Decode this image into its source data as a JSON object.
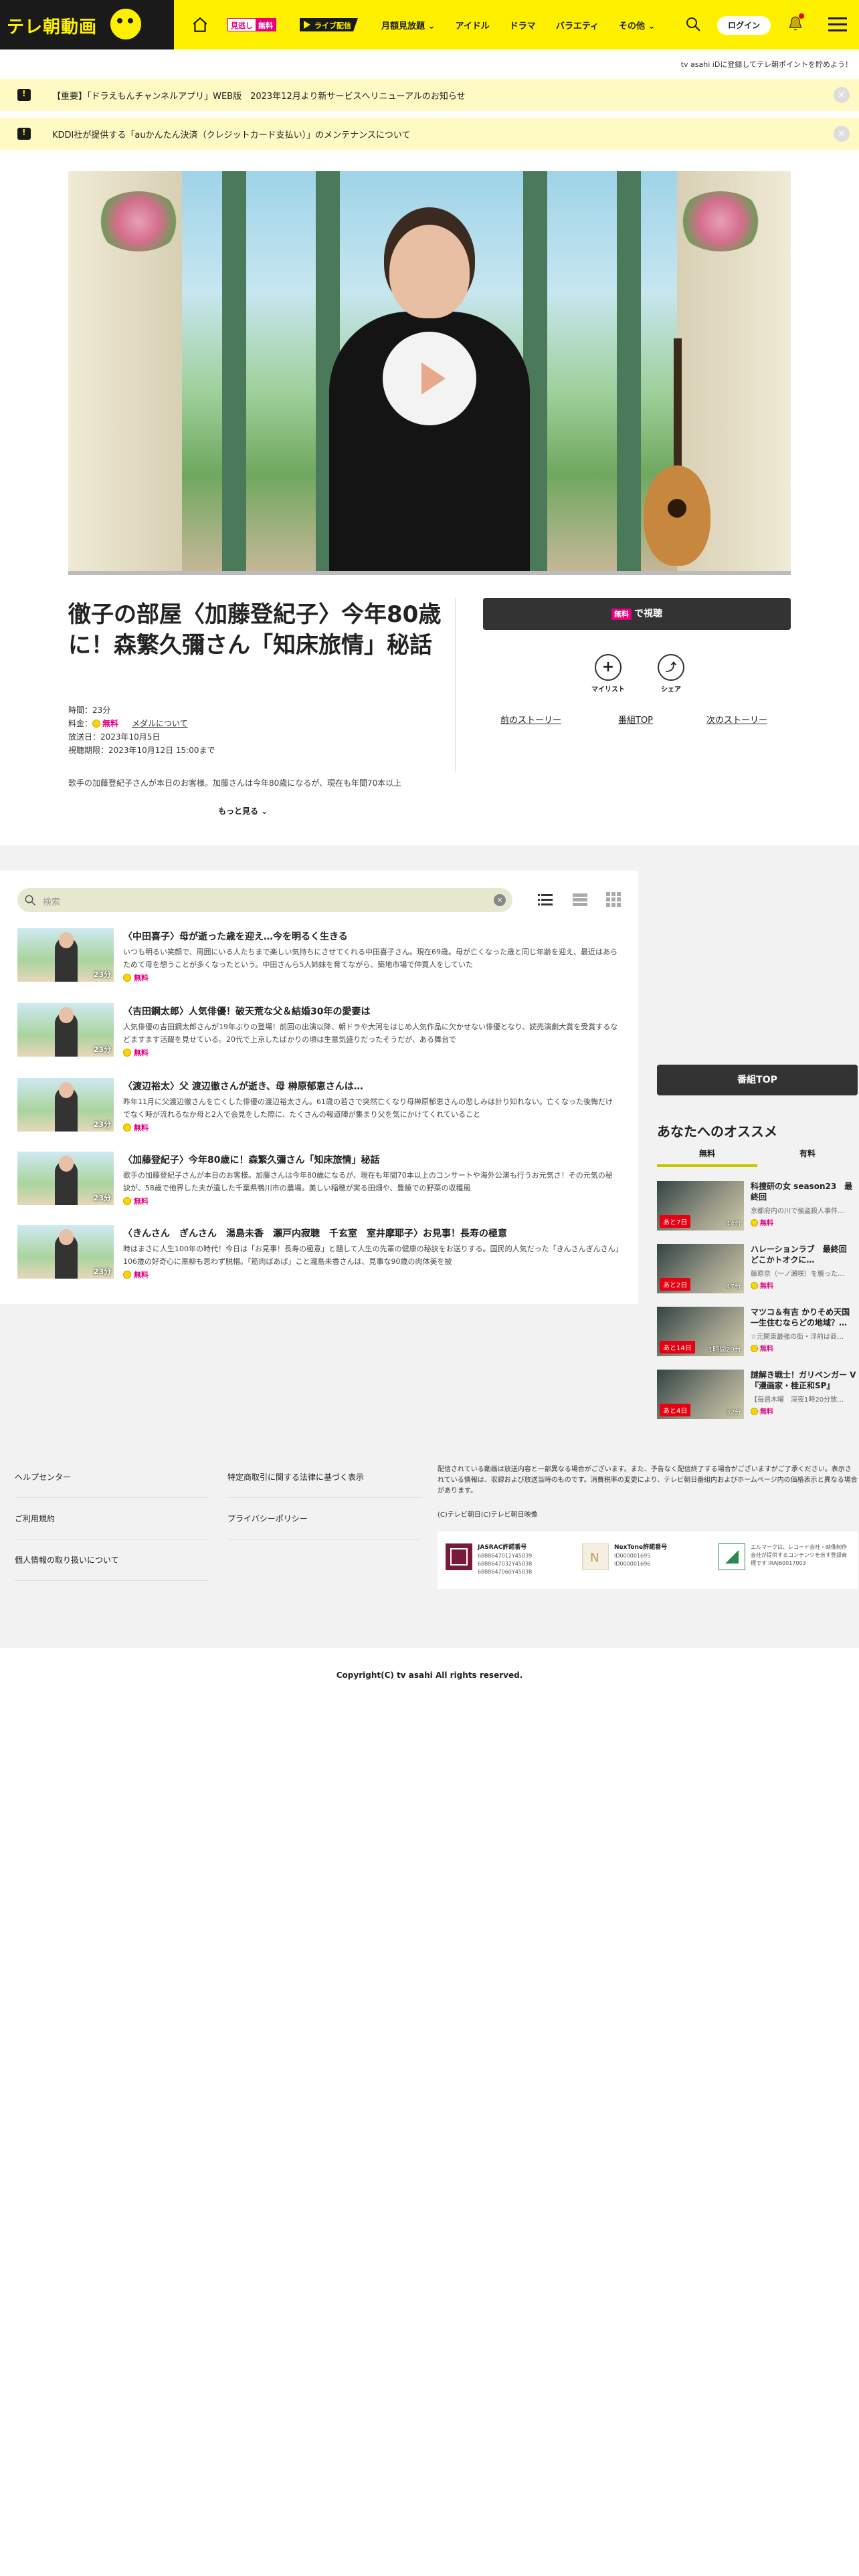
{
  "header": {
    "logo": "テレ朝動画",
    "mitoshi_a": "見逃し",
    "mitoshi_b": "無料",
    "live": "ライブ配信",
    "nav": [
      "月額見放題",
      "アイドル",
      "ドラマ",
      "バラエティ",
      "その他"
    ],
    "login": "ログイン"
  },
  "point_note": "tv asahi iDに登録してテレ朝ポイントを貯めよう！",
  "notices": [
    "【重要】「ドラえもんチャンネルアプリ」WEB版　2023年12月より新サービスへリニューアルのお知らせ",
    "KDDI社が提供する「auかんたん決済（クレジットカード支払い）」のメンテナンスについて"
  ],
  "episode": {
    "title": "徹子の部屋〈加藤登紀子〉今年80歳に！森繁久彌さん「知床旅情」秘話",
    "time": "時間：23分",
    "price_label": "料金：",
    "price": "無料",
    "member": "メダルについて",
    "aired": "放送日：2023年10月5日",
    "expire": "視聴期限：2023年10月12日 15:00まで",
    "description": "歌手の加藤登紀子さんが本日のお客様。加藤さんは今年80歳になるが、現在も年間70本以上",
    "more": "もっと見る ⌄"
  },
  "actions": {
    "watch_badge": "無料",
    "watch": "で視聴",
    "mylist": "マイリスト",
    "share": "シェア",
    "prev": "前のストーリー",
    "top": "番組TOP",
    "next": "次のストーリー"
  },
  "search": {
    "placeholder": "検索"
  },
  "list": [
    {
      "title": "〈中田喜子〉母が逝った歳を迎え…今を明るく生きる",
      "desc": "いつも明るい笑顔で、周囲にいる人たちまで楽しい気持ちにさせてくれる中田喜子さん。現在69歳。母が亡くなった歳と同じ年齢を迎え、最近はあらためて母を想うことが多くなったという。中田さんら5人姉妹を育てながら、築地市場で仲買人をしていた",
      "dur": "23分",
      "free": "無料"
    },
    {
      "title": "〈吉田鋼太郎〉人気俳優！破天荒な父＆結婚30年の愛妻は",
      "desc": "人気俳優の吉田鋼太郎さんが19年ぶりの登場！前回の出演以降、朝ドラや大河をはじめ人気作品に欠かせない俳優となり、読売演劇大賞を受賞するなどますます活躍を見せている。20代で上京したばかりの頃は生意気盛りだったそうだが、ある舞台で",
      "dur": "23分",
      "free": "無料"
    },
    {
      "title": "〈渡辺裕太〉父 渡辺徹さんが逝き、母 榊原郁恵さんは…",
      "desc": "昨年11月に父渡辺徹さんを亡くした俳優の渡辺裕太さん。61歳の若さで突然亡くなり母榊原郁恵さんの悲しみは計り知れない。亡くなった後悔だけでなく時が流れるなか母と2人で会見をした際に、たくさんの報道陣が集まり父を気にかけてくれていること",
      "dur": "23分",
      "free": "無料"
    },
    {
      "title": "〈加藤登紀子〉今年80歳に！森繁久彌さん「知床旅情」秘話",
      "desc": "歌手の加藤登紀子さんが本日のお客様。加藤さんは今年80歳になるが、現在も年間70本以上のコンサートや海外公演も行うお元気さ！その元気の秘訣が、58歳で他界した夫が遺した千葉県鴨川市の農場。美しい稲穂が実る田畑や、豊饒での野菜の収穫風",
      "dur": "23分",
      "free": "無料"
    },
    {
      "title": "〈きんさん　ぎんさん　湯島未香　瀬戸内寂聴　千玄室　室井摩耶子〉お見事！長寿の極意",
      "desc": "時はまさに人生100年の時代！今日は「お見事！長寿の極意」と題して人生の先輩の健康の秘訣をお送りする。国民的人気だった「きんさんぎんさん」106歳の好奇心に黒柳も思わず脱帽。「筋肉ばあば」こと瀧島未香さんは、見事な90歳の肉体美を披",
      "dur": "23分",
      "free": "無料"
    }
  ],
  "sidebar": {
    "top_button": "番組TOP",
    "rec_title": "あなたへのオススメ",
    "tabs": [
      "無料",
      "有料"
    ],
    "items": [
      {
        "name": "科捜研の女 season23　最終回",
        "sub": "京都府内の川で強盗殺人事件…",
        "days": "あと7日",
        "dur": "44分",
        "free": "無料"
      },
      {
        "name": "ハレーションラブ　最終回　どこかトオクに…",
        "sub": "藤原奈（一ノ瀬咲）を襲った…",
        "days": "あと2日",
        "dur": "47分",
        "free": "無料"
      },
      {
        "name": "マツコ＆有吉 かりそめ天国　一生住むならどの地域？…",
        "sub": "☆元関東最強の街・浮前は商…",
        "days": "あと14日",
        "dur": "1時間29分",
        "free": "無料"
      },
      {
        "name": "謎解き戦士！ガリベンガー V　『漫画家・桂正和SP』",
        "sub": "【毎週木曜　深夜1時20分放…",
        "days": "あと4日",
        "dur": "32分",
        "free": "無料"
      }
    ]
  },
  "footer": {
    "links": [
      "ヘルプセンター",
      "ご利用規約",
      "個人情報の取り扱いについて",
      "特定商取引に関する法律に基づく表示",
      "プライバシーポリシー"
    ],
    "note": "配信されている動画は放送内容と一部異なる場合がございます。また、予告なく配信終了する場合がございますがご了承ください。表示されている情報は、収録および放送当時のものです。消費税率の変更により、テレビ朝日番組内およびホームページ内の価格表示と異なる場合があります。",
    "small_copy": "(C)テレビ朝日(C)テレビ朝日映像",
    "licenses": [
      {
        "title": "JASRAC許諾番号",
        "num": "6888647012Y45039\n6888647032Y45038\n6888647060Y45038"
      },
      {
        "title": "NexTone許諾番号",
        "num": "ID000001695\nID000001696"
      },
      {
        "title": "エルマーク",
        "num": "エルマークは、レコード会社・映像制作会社が提供するコンテンツを示す登録商標です\nIRAJ60017003"
      }
    ],
    "copyright": "Copyright(C) tv asahi All rights reserved."
  }
}
